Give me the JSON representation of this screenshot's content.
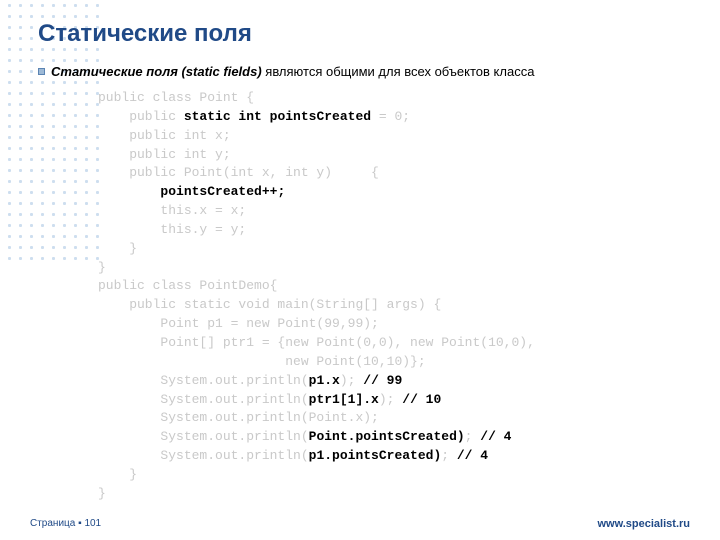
{
  "title": "Статические поля",
  "bullet": {
    "bold": "Статические поля (static fields)",
    "rest": " являются общими для всех объектов класса"
  },
  "code": {
    "l1a": "public class Point {",
    "l2a": "    public ",
    "l2b": "static int pointsCreated",
    "l2c": " = 0;",
    "l3a": "    public int x;",
    "l4a": "    public int y;",
    "l5a": "    public Point(int x, int y)     {",
    "l6a": "        ",
    "l6b": "pointsCreated++;",
    "l7a": "        this.x = x;",
    "l8a": "        this.y = y;",
    "l9a": "    }",
    "l10a": "}",
    "l11a": "public class PointDemo{",
    "l12a": "    public static void main(String[] args) {",
    "l13a": "        Point p1 = new Point(99,99);",
    "l14a": "        Point[] ptr1 = {new Point(0,0), new Point(10,0),",
    "l15a": "                        new Point(10,10)};",
    "l16a": "        System.out.println(",
    "l16b": "p1.x",
    "l16c": "); ",
    "l16d": "// 99",
    "l17a": "        System.out.println(",
    "l17b": "ptr1[1].x",
    "l17c": "); ",
    "l17d": "// 10",
    "l18a": "        System.out.println(Point.x);",
    "l19a": "        System.out.println(",
    "l19b": "Point.pointsCreated)",
    "l19c": "; ",
    "l19d": "// 4",
    "l20a": "        System.out.println(",
    "l20b": "p1.pointsCreated)",
    "l20c": "; ",
    "l20d": "// 4",
    "l21a": "    }",
    "l22a": "}"
  },
  "footer": {
    "page_prefix": "Страница ▪ ",
    "page_number": "101",
    "url": "www.specialist.ru"
  }
}
